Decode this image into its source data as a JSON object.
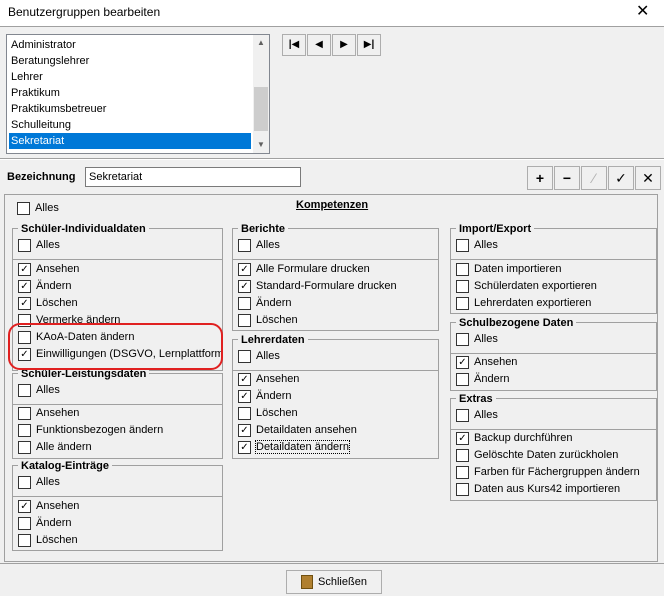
{
  "window": {
    "title": "Benutzergruppen bearbeiten",
    "close_glyph": "✕"
  },
  "list": {
    "items": [
      "Administrator",
      "Beratungslehrer",
      "Lehrer",
      "Praktikum",
      "Praktikumsbetreuer",
      "Schulleitung",
      "Sekretariat"
    ],
    "selected": "Sekretariat"
  },
  "nav": {
    "first": "|◀",
    "prev": "◀",
    "next": "▶",
    "last": "▶|"
  },
  "bezeichnung": {
    "label": "Bezeichnung",
    "value": "Sekretariat"
  },
  "toolbar": {
    "add": "+",
    "remove": "−",
    "edit": "⁄",
    "confirm": "✓",
    "cancel": "✕"
  },
  "alles_global": {
    "label": "Alles",
    "checked": false
  },
  "kompetenzen_title": "Kompetenzen",
  "groups": {
    "schueler_individual": {
      "title": "Schüler-Individualdaten",
      "alles": "Alles",
      "items": [
        {
          "label": "Ansehen",
          "checked": true
        },
        {
          "label": "Ändern",
          "checked": true
        },
        {
          "label": "Löschen",
          "checked": true
        },
        {
          "label": "Vermerke ändern",
          "checked": false
        },
        {
          "label": "KAoA-Daten ändern",
          "checked": false
        },
        {
          "label": "Einwilligungen (DSGVO, Lernplattforme",
          "checked": true
        }
      ]
    },
    "schueler_leistung": {
      "title": "Schüler-Leistungsdaten",
      "alles": "Alles",
      "items": [
        {
          "label": "Ansehen",
          "checked": false
        },
        {
          "label": "Funktionsbezogen ändern",
          "checked": false
        },
        {
          "label": "Alle ändern",
          "checked": false
        }
      ]
    },
    "katalog": {
      "title": "Katalog-Einträge",
      "alles": "Alles",
      "items": [
        {
          "label": "Ansehen",
          "checked": true
        },
        {
          "label": "Ändern",
          "checked": false
        },
        {
          "label": "Löschen",
          "checked": false
        }
      ]
    },
    "berichte": {
      "title": "Berichte",
      "alles": "Alles",
      "items": [
        {
          "label": "Alle Formulare drucken",
          "checked": true
        },
        {
          "label": "Standard-Formulare drucken",
          "checked": true
        },
        {
          "label": "Ändern",
          "checked": false
        },
        {
          "label": "Löschen",
          "checked": false
        }
      ]
    },
    "lehrerdaten": {
      "title": "Lehrerdaten",
      "alles": "Alles",
      "items": [
        {
          "label": "Ansehen",
          "checked": true
        },
        {
          "label": "Ändern",
          "checked": true
        },
        {
          "label": "Löschen",
          "checked": false
        },
        {
          "label": "Detaildaten ansehen",
          "checked": true
        },
        {
          "label": "Detaildaten ändern",
          "checked": true
        }
      ]
    },
    "import_export": {
      "title": "Import/Export",
      "alles": "Alles",
      "items": [
        {
          "label": "Daten importieren",
          "checked": false
        },
        {
          "label": "Schülerdaten exportieren",
          "checked": false
        },
        {
          "label": "Lehrerdaten exportieren",
          "checked": false
        }
      ]
    },
    "schulbezogen": {
      "title": "Schulbezogene Daten",
      "alles": "Alles",
      "items": [
        {
          "label": "Ansehen",
          "checked": true
        },
        {
          "label": "Ändern",
          "checked": false
        }
      ]
    },
    "extras": {
      "title": "Extras",
      "alles": "Alles",
      "items": [
        {
          "label": "Backup durchführen",
          "checked": true
        },
        {
          "label": "Gelöschte Daten zurückholen",
          "checked": false
        },
        {
          "label": "Farben für Fächergruppen ändern",
          "checked": false
        },
        {
          "label": "Daten aus Kurs42 importieren",
          "checked": false
        }
      ]
    }
  },
  "footer": {
    "close_label": "Schließen"
  },
  "colors": {
    "selection": "#0078d7",
    "highlight_oval": "#e02020"
  }
}
